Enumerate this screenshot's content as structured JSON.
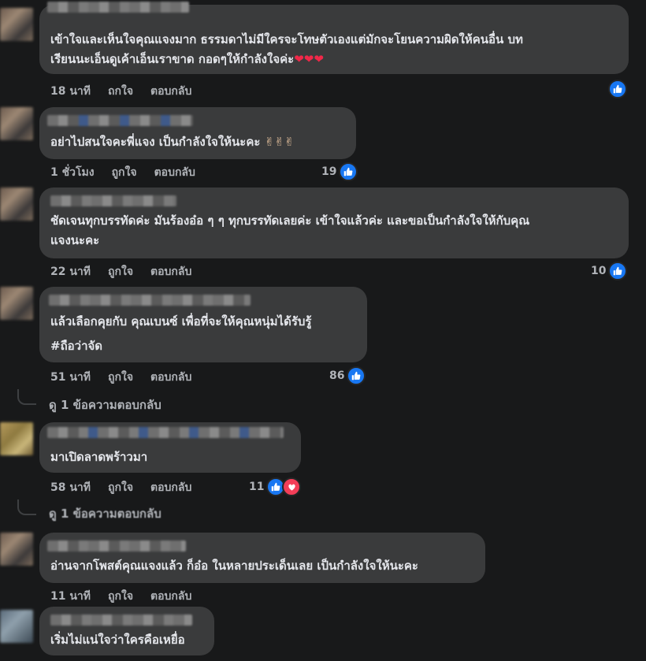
{
  "labels": {
    "like": "ถูกใจ",
    "reply": "ตอบกลับ"
  },
  "comments": [
    {
      "text": "เข้าใจและเห็นใจคุณแจงมาก ธรรมดาไม่มีใครจะโทษตัวเองแต่มักจะโยนความผิดให้คนอื่น บท\nเรียนนะเอ็นดูเค้าเอ็นเราขาด กอดๆให้กำลังใจค่ะ",
      "emoji": "❤❤❤",
      "time": "18 นาที",
      "like_label": "ถกใจ",
      "reply_label": "ตอบกลับ",
      "reactions": ""
    },
    {
      "text": "อย่าไปสนใจคะพี่แจง เป็นกำลังใจให้นะคะ",
      "emoji": "✌✌✌",
      "time": "1 ชั่วโมง",
      "reactions": "19"
    },
    {
      "text": "ชัดเจนทุกบรรทัดค่ะ มันร้องอ๋อ ๆ ๆ ทุกบรรทัดเลยค่ะ เข้าใจแล้วค่ะ และขอเป็นกำลังใจให้กับคุณ\nแจงนะคะ",
      "time": "22 นาที",
      "reactions": "10"
    },
    {
      "text": "แล้วเลือกคุยกับ คุณเบนซ์ เพื่อที่จะให้คุณหนุ่มได้รับรู้",
      "hashtag": "#ถือว่าจัด",
      "time": "51 นาที",
      "reactions": "86",
      "view_replies": "ดู 1 ข้อความตอบกลับ"
    },
    {
      "text": "มาเปิดลาดพร้าวมา",
      "time": "58 นาที",
      "reactions": "11",
      "view_replies": "ดู 1 ข้อความตอบกลับ"
    },
    {
      "text": "อ่านจากโพสต์คุณแจงแล้ว ก็อ๋อ ในหลายประเด็นเลย เป็นกำลังใจให้นะคะ",
      "time": "11 นาที",
      "reactions": ""
    },
    {
      "text": "เริ่มไม่แน่ใจว่าใครคือเหยื่อ"
    }
  ],
  "colors": {
    "background": "#18191a",
    "bubble": "#3a3b3c",
    "like_blue": "#1877f2",
    "heart_red": "#f33e58"
  },
  "icons": {
    "like": "thumbs-up-icon",
    "love": "heart-icon"
  }
}
